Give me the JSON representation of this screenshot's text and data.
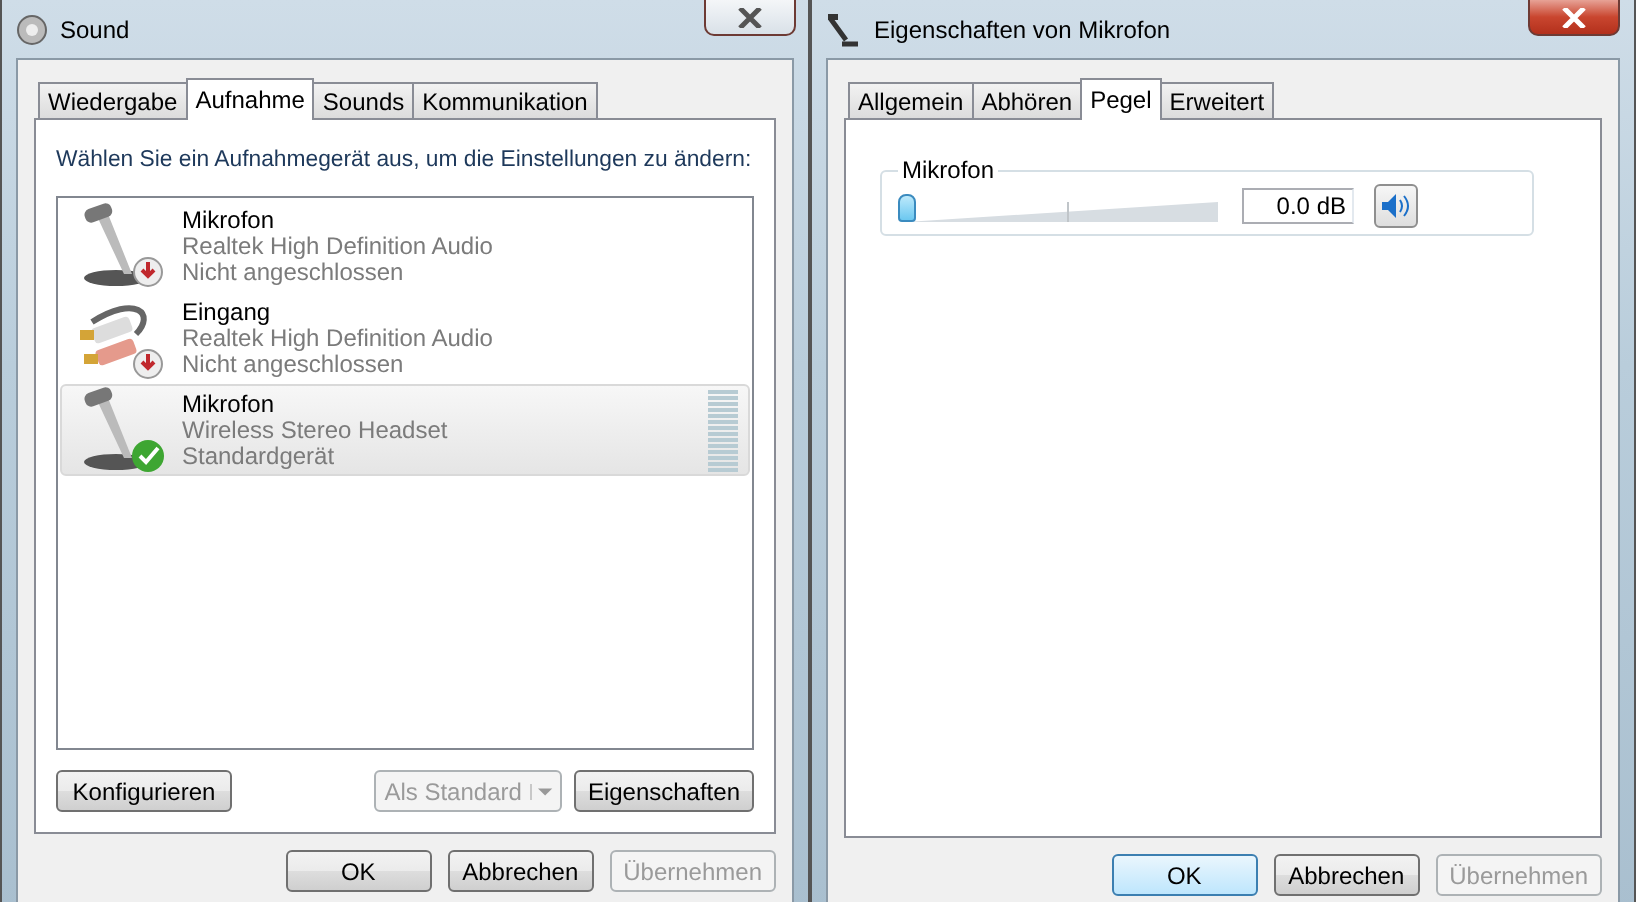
{
  "sound_window": {
    "title": "Sound",
    "tabs": [
      {
        "label": "Wiedergabe",
        "selected": false
      },
      {
        "label": "Aufnahme",
        "selected": true
      },
      {
        "label": "Sounds",
        "selected": false
      },
      {
        "label": "Kommunikation",
        "selected": false
      }
    ],
    "instruction": "Wählen Sie ein Aufnahmegerät aus, um die Einstellungen zu ändern:",
    "devices": [
      {
        "name": "Mikrofon",
        "description": "Realtek High Definition Audio",
        "status": "Nicht angeschlossen",
        "kind": "microphone",
        "connected": false,
        "default": false,
        "selected": false
      },
      {
        "name": "Eingang",
        "description": "Realtek High Definition Audio",
        "status": "Nicht angeschlossen",
        "kind": "line-in",
        "connected": false,
        "default": false,
        "selected": false
      },
      {
        "name": "Mikrofon",
        "description": "Wireless Stereo Headset",
        "status": "Standardgerät",
        "kind": "microphone",
        "connected": true,
        "default": true,
        "selected": true,
        "meter": true
      }
    ],
    "actions": [
      {
        "label": "Konfigurieren",
        "kind": "button",
        "disabled": false
      },
      {
        "label": "Als Standard",
        "kind": "split",
        "disabled": true
      },
      {
        "label": "Eigenschaften",
        "kind": "button",
        "disabled": false
      }
    ],
    "buttons": [
      {
        "label": "OK",
        "disabled": false,
        "focused": false
      },
      {
        "label": "Abbrechen",
        "disabled": false,
        "focused": false
      },
      {
        "label": "Übernehmen",
        "disabled": true,
        "focused": false
      }
    ]
  },
  "properties_window": {
    "title": "Eigenschaften von Mikrofon",
    "tabs": [
      {
        "label": "Allgemein",
        "selected": false
      },
      {
        "label": "Abhören",
        "selected": false
      },
      {
        "label": "Pegel",
        "selected": true
      },
      {
        "label": "Erweitert",
        "selected": false
      }
    ],
    "level_group": {
      "label": "Mikrofon",
      "level": 0,
      "value": "0.0 dB",
      "muted": false
    },
    "buttons": [
      {
        "label": "OK",
        "disabled": false,
        "focused": true
      },
      {
        "label": "Abbrechen",
        "disabled": false,
        "focused": false
      },
      {
        "label": "Übernehmen",
        "disabled": true,
        "focused": false
      }
    ]
  }
}
